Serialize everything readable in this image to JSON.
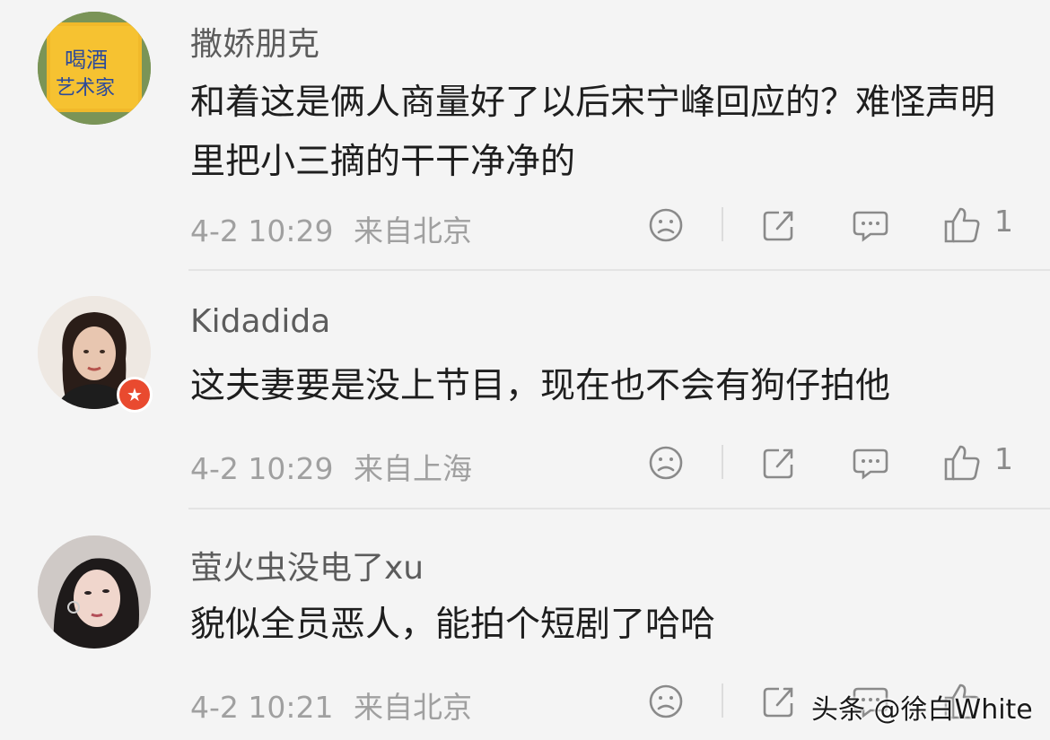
{
  "comments": [
    {
      "username": "撒娇朋克",
      "text": "和着这是俩人商量好了以后宋宁峰回应的？难怪声明里把小三摘的干干净净的",
      "time": "4-2 10:29",
      "location": "来自北京",
      "likes": "1",
      "avatar_desc": "yellow-sign-avatar"
    },
    {
      "username": "Kidadida",
      "text": "这夫妻要是没上节目，现在也不会有狗仔拍他",
      "time": "4-2 10:29",
      "location": "来自上海",
      "likes": "1",
      "avatar_desc": "woman-portrait-avatar"
    },
    {
      "username": "萤火虫没电了xu",
      "text": "貌似全员恶人，能拍个短剧了哈哈",
      "time": "4-2 10:21",
      "location": "来自北京",
      "likes": "",
      "avatar_desc": "woman-portrait-avatar"
    }
  ],
  "watermark": "头条 @徐白White",
  "icons": [
    "dislike-face-icon",
    "share-icon",
    "comment-icon",
    "thumbs-up-icon",
    "verified-badge-icon"
  ],
  "colors": {
    "badge": "#e94a2f",
    "text": "#1e1e1e",
    "meta": "#a0a0a0",
    "username": "#5c5c5c"
  }
}
